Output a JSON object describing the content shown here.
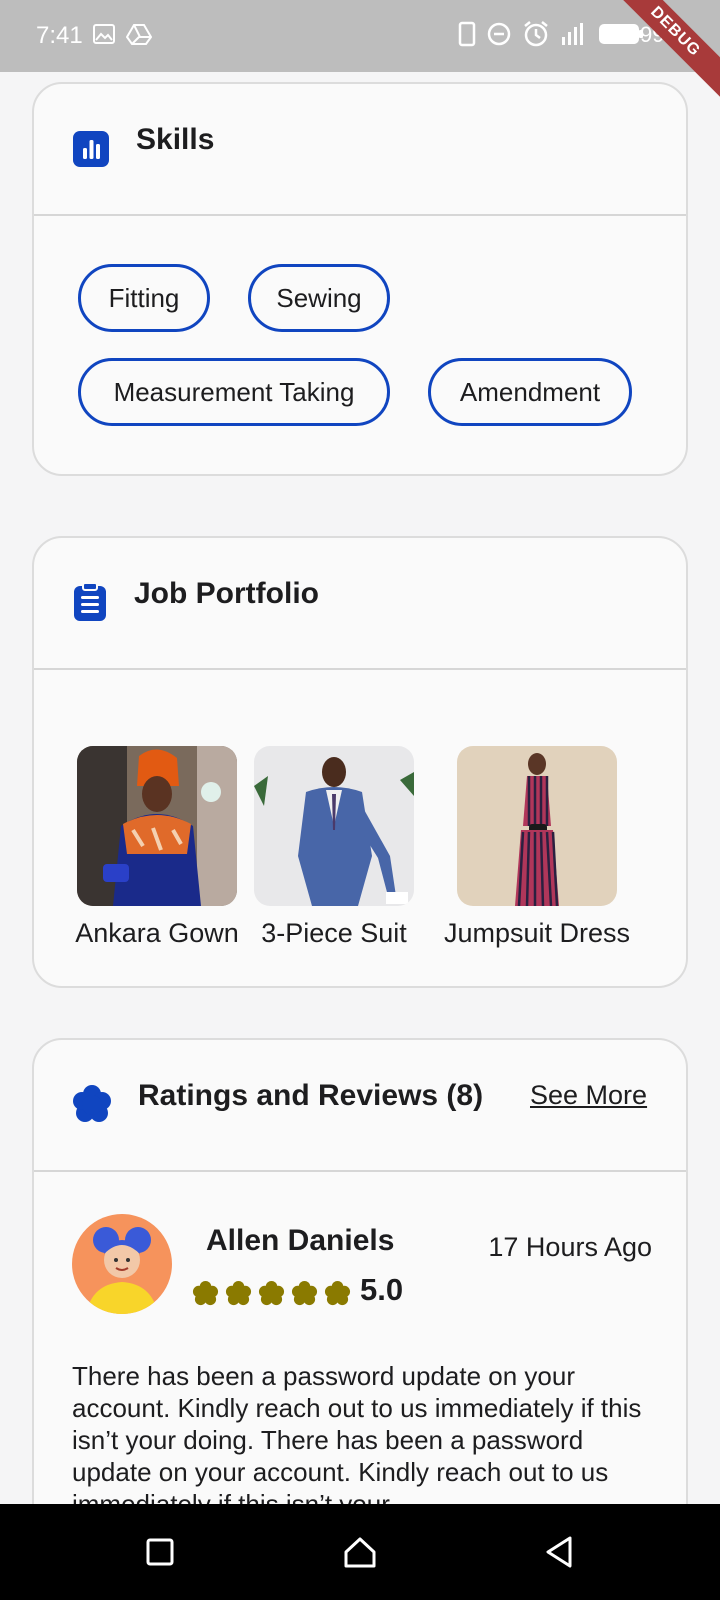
{
  "status_bar": {
    "time": "7:41",
    "battery": "99%",
    "debug_label": "DEBUG"
  },
  "skills": {
    "title": "Skills",
    "chips": [
      "Fitting",
      "Sewing",
      "Measurement Taking",
      "Amendment"
    ]
  },
  "portfolio": {
    "title": "Job Portfolio",
    "items": [
      {
        "caption": "Ankara Gown"
      },
      {
        "caption": "3-Piece Suit"
      },
      {
        "caption": "Jumpsuit Dress"
      }
    ]
  },
  "reviews": {
    "title": "Ratings and Reviews (8)",
    "see_more": "See More",
    "review": {
      "name": "Allen Daniels",
      "rating": "5.0",
      "stars": 5,
      "time": "17 Hours Ago",
      "text": "There has been a password update on your account. Kindly reach out to us immediately if this isn’t your doing. There has been a password update on your account. Kindly reach out to us immediately if this isn’t your"
    }
  },
  "colors": {
    "accent": "#1045c0",
    "star": "#8a7a00",
    "card_bg": "#fafafa",
    "page_bg": "#f5f5f6"
  },
  "icons": {
    "skills": "bar-chart-icon",
    "portfolio": "clipboard-icon",
    "reviews": "flower-badge-icon"
  }
}
